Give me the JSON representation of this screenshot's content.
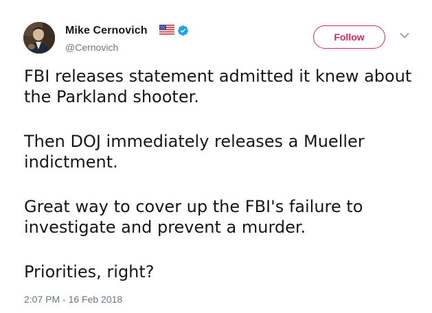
{
  "author": {
    "display_name": "Mike Cernovich",
    "handle": "@Cernovich",
    "badges": [
      "us-flag-icon",
      "verified-badge-icon"
    ]
  },
  "actions": {
    "follow_label": "Follow",
    "more_icon": "chevron-down-icon"
  },
  "tweet": {
    "paragraphs": [
      "FBI releases statement admitted it knew about the Parkland shooter.",
      "Then DOJ immediately releases a Mueller indictment.",
      "Great way to cover up the FBI's failure to investigate and prevent a murder.",
      "Priorities, right?"
    ],
    "timestamp": "2:07 PM - 16 Feb 2018"
  },
  "colors": {
    "text_primary": "#14171a",
    "text_secondary": "#657786",
    "follow_accent": "#e0245e",
    "verified_blue": "#1da1f2"
  }
}
